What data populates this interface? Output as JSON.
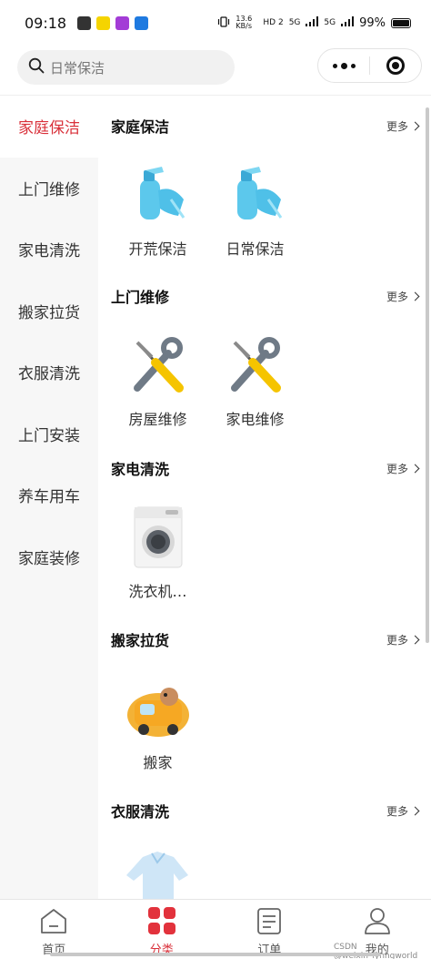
{
  "status_bar": {
    "time": "09:18",
    "net_speed": "13.6 KB/s",
    "network_1": "HD 2",
    "network_2": "5G",
    "network_3": "5G",
    "battery": "99%"
  },
  "search": {
    "placeholder": "日常保洁"
  },
  "sidebar": {
    "items": [
      {
        "label": "家庭保洁",
        "active": true
      },
      {
        "label": "上门维修",
        "active": false
      },
      {
        "label": "家电清洗",
        "active": false
      },
      {
        "label": "搬家拉货",
        "active": false
      },
      {
        "label": "衣服清洗",
        "active": false
      },
      {
        "label": "上门安装",
        "active": false
      },
      {
        "label": "养车用车",
        "active": false
      },
      {
        "label": "家庭装修",
        "active": false
      }
    ]
  },
  "sections": [
    {
      "title": "家庭保洁",
      "more": "更多",
      "items": [
        {
          "label": "开荒保洁",
          "icon": "cleaning-spray-icon"
        },
        {
          "label": "日常保洁",
          "icon": "cleaning-spray-icon"
        }
      ]
    },
    {
      "title": "上门维修",
      "more": "更多",
      "items": [
        {
          "label": "房屋维修",
          "icon": "tools-icon"
        },
        {
          "label": "家电维修",
          "icon": "tools-icon"
        }
      ]
    },
    {
      "title": "家电清洗",
      "more": "更多",
      "items": [
        {
          "label": "洗衣机…",
          "icon": "washing-machine-icon"
        }
      ]
    },
    {
      "title": "搬家拉货",
      "more": "更多",
      "items": [
        {
          "label": "搬家",
          "icon": "moving-truck-icon"
        }
      ]
    },
    {
      "title": "衣服清洗",
      "more": "更多",
      "items": [
        {
          "label": "",
          "icon": "shirt-icon"
        }
      ]
    }
  ],
  "tabbar": {
    "tabs": [
      {
        "label": "首页",
        "icon": "home-icon",
        "active": false
      },
      {
        "label": "分类",
        "icon": "category-icon",
        "active": true
      },
      {
        "label": "订单",
        "icon": "order-icon",
        "active": false
      },
      {
        "label": "我的",
        "icon": "user-icon",
        "active": false
      }
    ]
  },
  "watermark": "CSDN @weixin_lynhgworld",
  "colors": {
    "accent": "#d9303a",
    "sidebar_bg": "#f7f7f7"
  }
}
